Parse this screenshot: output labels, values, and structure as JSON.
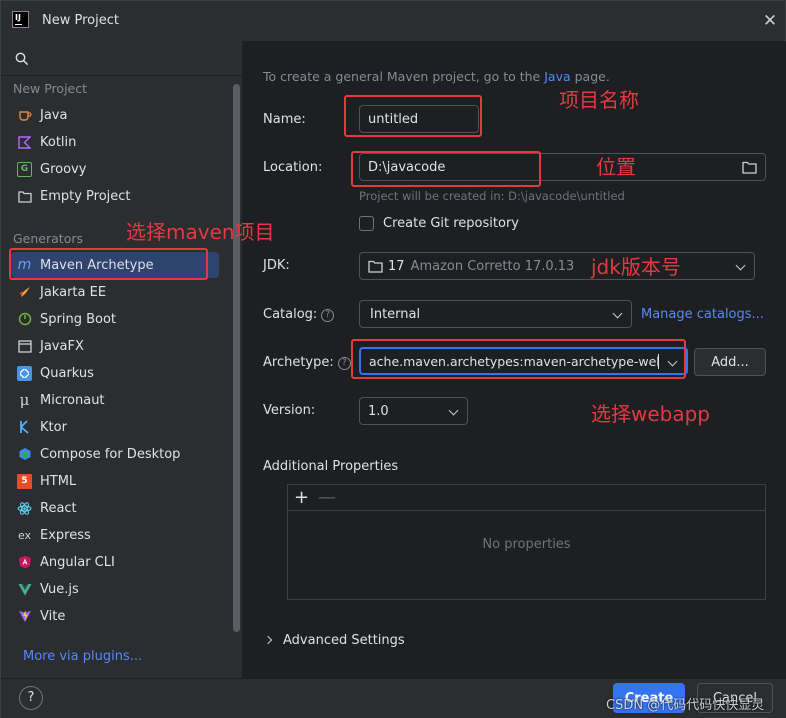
{
  "window": {
    "title": "New Project",
    "close_glyph": "✕"
  },
  "sidebar": {
    "section_new_project": "New Project",
    "new_project_items": [
      {
        "label": "Java",
        "icon": "java-cup-icon"
      },
      {
        "label": "Kotlin",
        "icon": "kotlin-icon"
      },
      {
        "label": "Groovy",
        "icon": "groovy-icon"
      },
      {
        "label": "Empty Project",
        "icon": "empty-project-icon"
      }
    ],
    "section_generators": "Generators",
    "generator_items": [
      {
        "label": "Maven Archetype",
        "icon": "maven-icon",
        "selected": true
      },
      {
        "label": "Jakarta EE",
        "icon": "jakarta-icon"
      },
      {
        "label": "Spring Boot",
        "icon": "spring-boot-icon"
      },
      {
        "label": "JavaFX",
        "icon": "javafx-icon"
      },
      {
        "label": "Quarkus",
        "icon": "quarkus-icon"
      },
      {
        "label": "Micronaut",
        "icon": "micronaut-icon"
      },
      {
        "label": "Ktor",
        "icon": "ktor-icon"
      },
      {
        "label": "Compose for Desktop",
        "icon": "compose-icon"
      },
      {
        "label": "HTML",
        "icon": "html5-icon"
      },
      {
        "label": "React",
        "icon": "react-icon"
      },
      {
        "label": "Express",
        "icon": "express-icon"
      },
      {
        "label": "Angular CLI",
        "icon": "angular-icon"
      },
      {
        "label": "Vue.js",
        "icon": "vue-icon"
      },
      {
        "label": "Vite",
        "icon": "vite-icon"
      }
    ],
    "more_plugins": "More via plugins..."
  },
  "form": {
    "hint_prefix": "To create a general Maven project, go to the ",
    "hint_link": "Java",
    "hint_suffix": " page.",
    "name_label": "Name:",
    "name_value": "untitled",
    "location_label": "Location:",
    "location_value": "D:\\javacode",
    "location_hint": "Project will be created in: D:\\javacode\\untitled",
    "git_label": "Create Git repository",
    "jdk_label": "JDK:",
    "jdk_version": "17",
    "jdk_name": "Amazon Corretto 17.0.13",
    "catalog_label": "Catalog:",
    "catalog_value": "Internal",
    "manage_catalogs": "Manage catalogs...",
    "archetype_label": "Archetype:",
    "archetype_value": "ache.maven.archetypes:maven-archetype-webapp",
    "add_button": "Add...",
    "version_label": "Version:",
    "version_value": "1.0",
    "additional_properties": "Additional Properties",
    "plus_glyph": "+",
    "minus_glyph": "—",
    "no_properties": "No properties",
    "advanced_settings": "Advanced Settings",
    "help_glyph": "?"
  },
  "footer": {
    "help_glyph": "?",
    "create_label": "Create",
    "cancel_label": "Cancel"
  },
  "annotations": {
    "name_note": "项目名称",
    "location_note": "位置",
    "maven_note": "选择maven项目",
    "jdk_note": "jdk版本号",
    "webapp_note": "选择webapp"
  },
  "watermark": "CSDN @代码代码快快显灵",
  "colors": {
    "accent": "#3574f0",
    "link": "#548af7",
    "selection": "#2e436e",
    "annotation": "#e5393f"
  }
}
